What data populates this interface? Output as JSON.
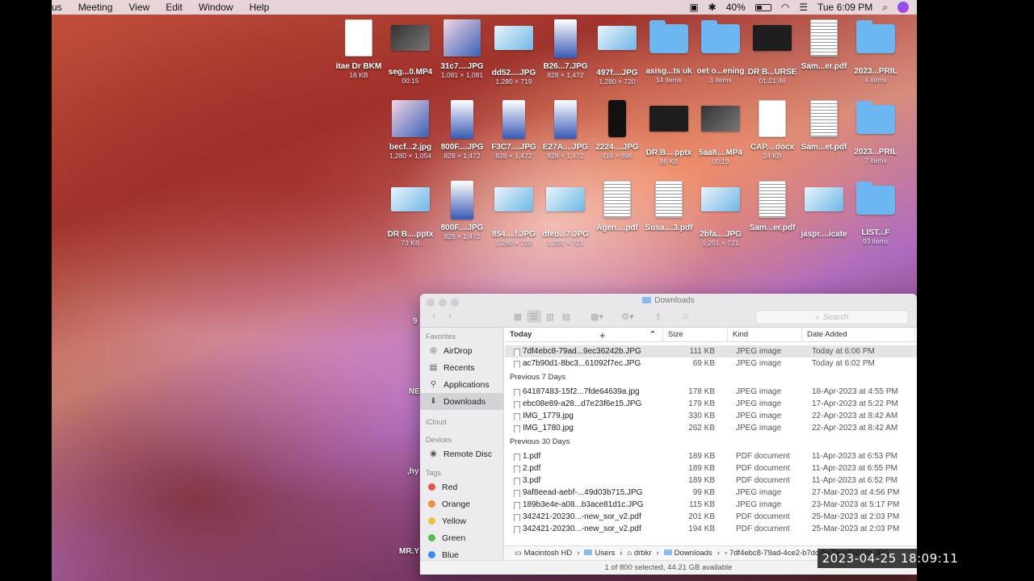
{
  "menubar": {
    "app_fragment": "us",
    "items": [
      "Meeting",
      "View",
      "Edit",
      "Window",
      "Help"
    ],
    "battery": "40%",
    "battery_level": 0.4,
    "clock": "Tue 6:09 PM"
  },
  "desktop": {
    "row1": [
      {
        "name": "itae Dr BKM",
        "sub": "16 KB",
        "kind": "doc"
      },
      {
        "name": "seg...0.MP4",
        "sub": "00:15",
        "kind": "video"
      },
      {
        "name": "31c7....JPG",
        "sub": "1,081 × 1,081",
        "kind": "img-sq"
      },
      {
        "name": "dd52....JPG",
        "sub": "1,280 × 719",
        "kind": "img-wide"
      },
      {
        "name": "B26...7.JPG",
        "sub": "828 × 1,472",
        "kind": "img-tall"
      },
      {
        "name": "497f....JPG",
        "sub": "1,280 × 720",
        "kind": "img-wide"
      },
      {
        "name": "asisg...ts uk",
        "sub": "14 items",
        "kind": "folder"
      },
      {
        "name": "oet o...ening",
        "sub": "3 items",
        "kind": "folder"
      },
      {
        "name": "DR B...URSE",
        "sub": "01:21:46",
        "kind": "dark"
      },
      {
        "name": "Sam...er.pdf",
        "sub": "",
        "kind": "pdf"
      },
      {
        "name": "2023...PRIL",
        "sub": "4 items",
        "kind": "folder"
      }
    ],
    "row2": [
      {
        "name": "becf...2.jpg",
        "sub": "1,280 × 1,054",
        "kind": "img-sq"
      },
      {
        "name": "800F....JPG",
        "sub": "828 × 1,472",
        "kind": "img-tall"
      },
      {
        "name": "F3C7....JPG",
        "sub": "828 × 1,472",
        "kind": "img-tall"
      },
      {
        "name": "E27A....JPG",
        "sub": "828 × 1,472",
        "kind": "img-tall"
      },
      {
        "name": "2224....JPG",
        "sub": "414 × 896",
        "kind": "phone"
      },
      {
        "name": "DR B....pptx",
        "sub": "86 KB",
        "kind": "dark"
      },
      {
        "name": "5aa8....MP4",
        "sub": "00:19",
        "kind": "video"
      },
      {
        "name": "CAP....docx",
        "sub": "24 KB",
        "kind": "doc"
      },
      {
        "name": "Sam...et.pdf",
        "sub": "",
        "kind": "pdf"
      },
      {
        "name": "2023...PRIL",
        "sub": "7 items",
        "kind": "folder"
      }
    ],
    "row3": [
      {
        "name": "DR B....pptx",
        "sub": "73 KB",
        "kind": "img-wide"
      },
      {
        "name": "800F....JPG",
        "sub": "828 × 1,472",
        "kind": "img-tall"
      },
      {
        "name": "854....f.JPG",
        "sub": "1,280 × 720",
        "kind": "img-wide"
      },
      {
        "name": "dfeb...7.JPG",
        "sub": "1,201 × 721",
        "kind": "img-wide"
      },
      {
        "name": "Agen....pdf",
        "sub": "",
        "kind": "pdf"
      },
      {
        "name": "Susa....3.pdf",
        "sub": "",
        "kind": "pdf"
      },
      {
        "name": "2bfa....JPG",
        "sub": "1,201 × 721",
        "kind": "img-wide"
      },
      {
        "name": "Sam...er.pdf",
        "sub": "",
        "kind": "pdf"
      },
      {
        "name": "jaspr....icate",
        "sub": "",
        "kind": "img-wide"
      },
      {
        "name": "LIST...F",
        "sub": "93 items",
        "kind": "folder"
      }
    ],
    "left_labels": [
      "NEH",
      "9",
      ",hy",
      "MR.Y"
    ]
  },
  "finder": {
    "title": "Downloads",
    "search_placeholder": "Search",
    "sidebar": {
      "favorites_header": "Favorites",
      "favorites": [
        "AirDrop",
        "Recents",
        "Applications",
        "Downloads"
      ],
      "icloud_header": "iCloud",
      "devices_header": "Devices",
      "devices": [
        "Remote Disc"
      ],
      "tags_header": "Tags",
      "tags": [
        {
          "label": "Red",
          "color": "#e5534b"
        },
        {
          "label": "Orange",
          "color": "#ef8d3a"
        },
        {
          "label": "Yellow",
          "color": "#e9c23b"
        },
        {
          "label": "Green",
          "color": "#5dbb4d"
        },
        {
          "label": "Blue",
          "color": "#3d8af7"
        }
      ]
    },
    "columns": {
      "name": "Today",
      "size": "Size",
      "kind": "Kind",
      "date": "Date Added"
    },
    "groups": [
      {
        "label": "",
        "rows": [
          {
            "name": "7df4ebc8-79ad...9ec36242b.JPG",
            "size": "111 KB",
            "kind": "JPEG image",
            "date": "Today at 6:06 PM",
            "selected": true
          },
          {
            "name": "ac7b90d1-8bc3...61092f7ec.JPG",
            "size": "69 KB",
            "kind": "JPEG image",
            "date": "Today at 6:02 PM"
          }
        ]
      },
      {
        "label": "Previous 7 Days",
        "rows": [
          {
            "name": "64187483-15f2...7fde64639a.jpg",
            "size": "178 KB",
            "kind": "JPEG image",
            "date": "18-Apr-2023 at 4:55 PM"
          },
          {
            "name": "ebc08e89-a28...d7e23f6e15.JPG",
            "size": "179 KB",
            "kind": "JPEG image",
            "date": "17-Apr-2023 at 5:22 PM"
          },
          {
            "name": "IMG_1779.jpg",
            "size": "330 KB",
            "kind": "JPEG image",
            "date": "22-Apr-2023 at 8:42 AM"
          },
          {
            "name": "IMG_1780.jpg",
            "size": "262 KB",
            "kind": "JPEG image",
            "date": "22-Apr-2023 at 8:42 AM"
          }
        ]
      },
      {
        "label": "Previous 30 Days",
        "rows": [
          {
            "name": "1.pdf",
            "size": "189 KB",
            "kind": "PDF document",
            "date": "11-Apr-2023 at 6:53 PM"
          },
          {
            "name": "2.pdf",
            "size": "189 KB",
            "kind": "PDF document",
            "date": "11-Apr-2023 at 6:55 PM"
          },
          {
            "name": "3.pdf",
            "size": "189 KB",
            "kind": "PDF document",
            "date": "11-Apr-2023 at 6:52 PM"
          },
          {
            "name": "9af8eead-aebf-...49d03b715.JPG",
            "size": "99 KB",
            "kind": "JPEG image",
            "date": "27-Mar-2023 at 4:56 PM"
          },
          {
            "name": "189b3e4e-a08...b3ace81d1c.JPG",
            "size": "115 KB",
            "kind": "JPEG image",
            "date": "23-Mar-2023 at 5:17 PM"
          },
          {
            "name": "342421-20230...-new_sor_v2.pdf",
            "size": "201 KB",
            "kind": "PDF document",
            "date": "25-Mar-2023 at 2:03 PM"
          },
          {
            "name": "342421-20230...-new_sor_v2.pdf",
            "size": "194 KB",
            "kind": "PDF document",
            "date": "25-Mar-2023 at 2:03 PM"
          }
        ]
      }
    ],
    "path": [
      "Macintosh HD",
      "Users",
      "drbkr",
      "Downloads",
      "7df4ebc8-79ad-4ce2-b7dc-9a79ec36242b.JPG"
    ],
    "status": "1 of 800 selected, 44.21 GB available"
  },
  "overlay_timestamp": "2023-04-25  18:09:11"
}
